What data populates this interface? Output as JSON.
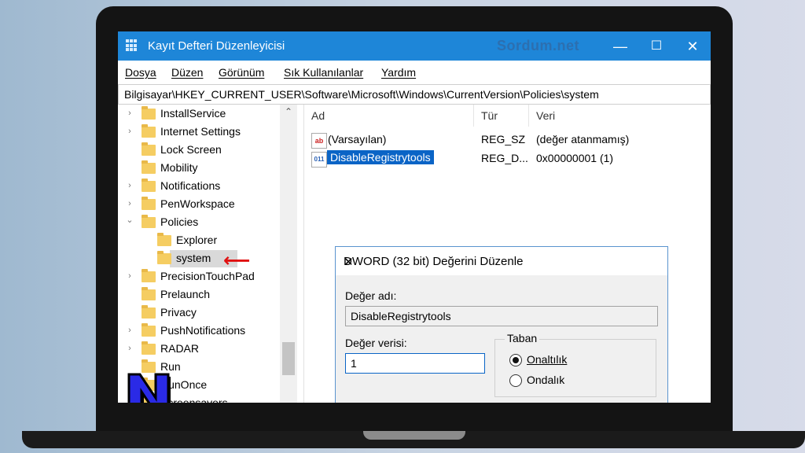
{
  "window": {
    "title": "Kayıt Defteri Düzenleyicisi",
    "watermark": "Sordum.net",
    "minimize": "—",
    "maximize": "☐",
    "close": "✕"
  },
  "menu": [
    "Dosya",
    "Düzen",
    "Görünüm",
    "Sık Kullanılanlar",
    "Yardım"
  ],
  "address": "Bilgisayar\\HKEY_CURRENT_USER\\Software\\Microsoft\\Windows\\CurrentVersion\\Policies\\system",
  "tree": [
    {
      "label": "InstallService",
      "chevron": "›"
    },
    {
      "label": "Internet Settings",
      "chevron": "›"
    },
    {
      "label": "Lock Screen",
      "chevron": ""
    },
    {
      "label": "Mobility",
      "chevron": ""
    },
    {
      "label": "Notifications",
      "chevron": "›"
    },
    {
      "label": "PenWorkspace",
      "chevron": "›"
    },
    {
      "label": "Policies",
      "chevron": "⌄"
    },
    {
      "label": "Explorer",
      "chevron": ""
    },
    {
      "label": "system",
      "chevron": ""
    },
    {
      "label": "PrecisionTouchPad",
      "chevron": "›"
    },
    {
      "label": "Prelaunch",
      "chevron": ""
    },
    {
      "label": "Privacy",
      "chevron": ""
    },
    {
      "label": "PushNotifications",
      "chevron": "›"
    },
    {
      "label": "RADAR",
      "chevron": "›"
    },
    {
      "label": "Run",
      "chevron": ""
    },
    {
      "label": "RunOnce",
      "chevron": ""
    },
    {
      "label": "Screensavers",
      "chevron": "›"
    }
  ],
  "values": {
    "columns": {
      "name": "Ad",
      "type": "Tür",
      "data": "Veri"
    },
    "rows": [
      {
        "icon": "ab",
        "name": "(Varsayılan)",
        "type": "REG_SZ",
        "data": "(değer atanmamış)"
      },
      {
        "icon": "011",
        "name": "DisableRegistrytools",
        "type": "REG_D...",
        "data": "0x00000001 (1)"
      }
    ]
  },
  "dialog": {
    "title": "DWORD (32 bit) Değerini Düzenle",
    "close": "✕",
    "name_label": "Değer adı:",
    "name_value": "DisableRegistrytools",
    "data_label": "Değer verisi:",
    "data_value": "1",
    "base_label": "Taban",
    "hex_label": "Onaltılık",
    "dec_label": "Ondalık"
  },
  "arrow": "⟵",
  "scroll_up": "⌃",
  "colors": {
    "titlebar": "#1e86d8",
    "selection": "#0a64c6",
    "arrow": "#e01010",
    "logo": "#2a2ae6"
  }
}
